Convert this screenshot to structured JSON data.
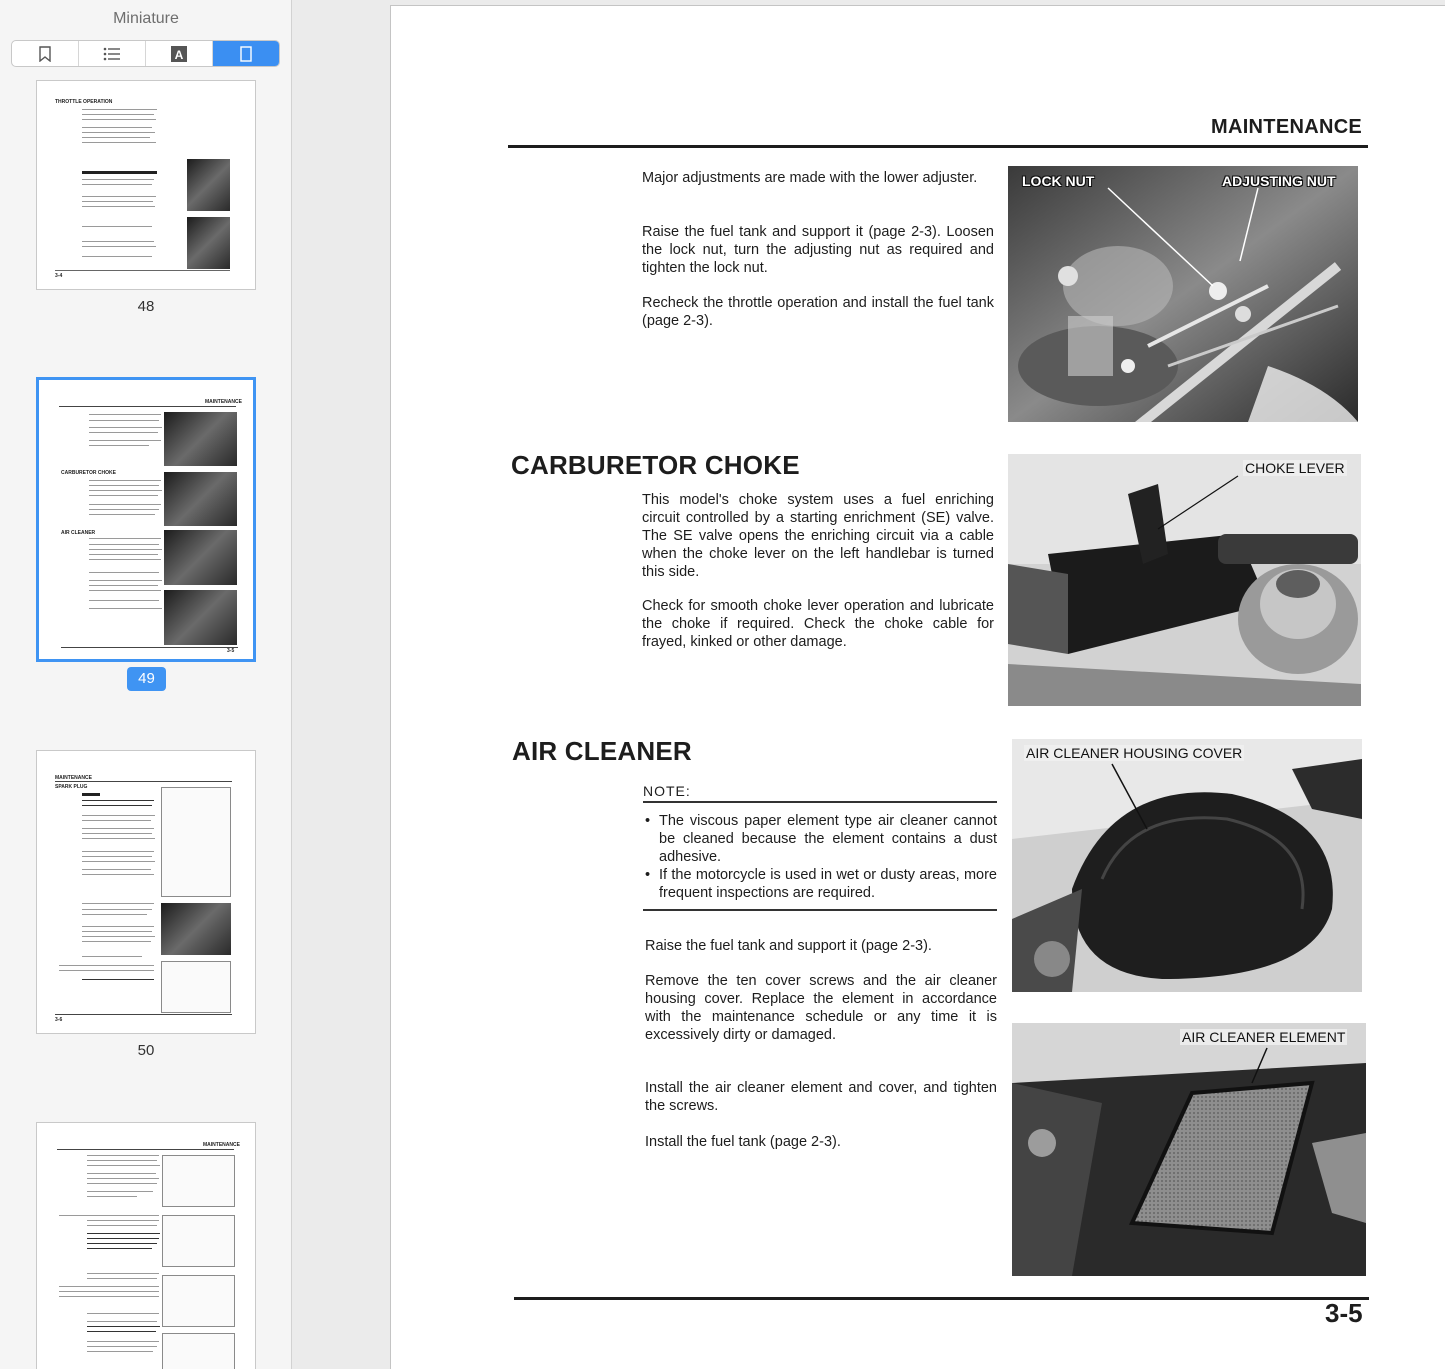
{
  "sidebar": {
    "title": "Miniature",
    "toolbar": [
      {
        "icon": "bookmark-icon"
      },
      {
        "icon": "list-icon"
      },
      {
        "icon": "highlight-icon",
        "glyph": "A"
      },
      {
        "icon": "page-icon"
      }
    ],
    "thumbnails": [
      {
        "page": "48",
        "heading": "THROTTLE OPERATION",
        "footer": "3-4"
      },
      {
        "page": "49",
        "heading": "MAINTENANCE",
        "footer": "3-5",
        "selected": true
      },
      {
        "page": "50",
        "heading": "MAINTENANCE",
        "footer": "3-6"
      },
      {
        "page": "",
        "heading": "MAINTENANCE",
        "footer": ""
      }
    ]
  },
  "document": {
    "header": "MAINTENANCE",
    "page_number": "3-5",
    "intro_paragraphs": [
      "Major adjustments are made with the lower adjuster.",
      "Raise the fuel tank and support it (page 2-3). Loosen the lock nut, turn the adjusting nut as required and tighten the lock nut.",
      "Recheck the throttle operation and install the fuel tank (page 2-3)."
    ],
    "photo1_labels": {
      "left": "LOCK NUT",
      "right": "ADJUSTING NUT"
    },
    "choke": {
      "title": "CARBURETOR CHOKE",
      "p1": "This model's choke system uses a fuel enriching circuit controlled by a starting enrichment (SE) valve. The SE valve opens the enriching circuit via a cable when the choke lever on the left handlebar is turned this side.",
      "p2": "Check for smooth choke lever operation and lubricate the choke if required. Check the choke cable for frayed, kinked or other damage.",
      "photo_label": "CHOKE LEVER"
    },
    "air_cleaner": {
      "title": "AIR CLEANER",
      "note_label": "NOTE:",
      "bullets": [
        "The viscous paper element type air cleaner cannot be cleaned because the element contains a dust adhesive.",
        "If the motorcycle is used in wet or dusty areas, more frequent inspections are required."
      ],
      "p1": "Raise the fuel tank and support it (page 2-3).",
      "p2": "Remove the ten cover screws and the air cleaner housing cover. Replace the element in accordance with the maintenance schedule or any time it is excessively dirty or damaged.",
      "p3": "Install the air cleaner element and cover, and tighten the screws.",
      "p4": "Install the fuel tank (page 2-3).",
      "photo_label_cover": "AIR CLEANER HOUSING COVER",
      "photo_label_element": "AIR CLEANER ELEMENT"
    }
  }
}
